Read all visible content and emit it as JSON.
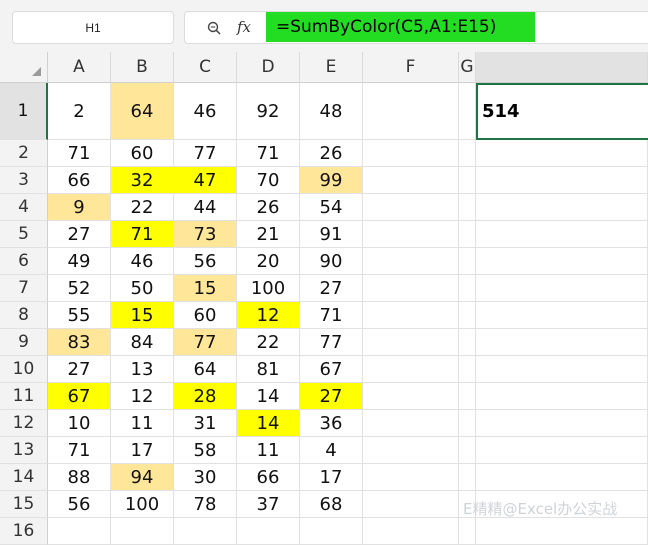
{
  "name_box": "H1",
  "formula": "=SumByColor(C5,A1:E15)",
  "colors": {
    "formula_highlight": "#22dd22",
    "yellow": "#ffff00",
    "light_orange": "#ffe699",
    "selection_border": "#217346"
  },
  "columns": [
    "A",
    "B",
    "C",
    "D",
    "E",
    "F",
    "G"
  ],
  "rows": [
    {
      "num": "1",
      "cells": [
        {
          "v": "2"
        },
        {
          "v": "64",
          "fill": "light_orange"
        },
        {
          "v": "46"
        },
        {
          "v": "92"
        },
        {
          "v": "48"
        }
      ]
    },
    {
      "num": "2",
      "cells": [
        {
          "v": "71"
        },
        {
          "v": "60"
        },
        {
          "v": "77"
        },
        {
          "v": "71"
        },
        {
          "v": "26"
        }
      ]
    },
    {
      "num": "3",
      "cells": [
        {
          "v": "66"
        },
        {
          "v": "32",
          "fill": "yellow"
        },
        {
          "v": "47",
          "fill": "yellow"
        },
        {
          "v": "70"
        },
        {
          "v": "99",
          "fill": "light_orange"
        }
      ]
    },
    {
      "num": "4",
      "cells": [
        {
          "v": "9",
          "fill": "light_orange"
        },
        {
          "v": "22"
        },
        {
          "v": "44"
        },
        {
          "v": "26"
        },
        {
          "v": "54"
        }
      ]
    },
    {
      "num": "5",
      "cells": [
        {
          "v": "27"
        },
        {
          "v": "71",
          "fill": "yellow"
        },
        {
          "v": "73",
          "fill": "light_orange"
        },
        {
          "v": "21"
        },
        {
          "v": "91"
        }
      ]
    },
    {
      "num": "6",
      "cells": [
        {
          "v": "49"
        },
        {
          "v": "46"
        },
        {
          "v": "56"
        },
        {
          "v": "20"
        },
        {
          "v": "90"
        }
      ]
    },
    {
      "num": "7",
      "cells": [
        {
          "v": "52"
        },
        {
          "v": "50"
        },
        {
          "v": "15",
          "fill": "light_orange"
        },
        {
          "v": "100"
        },
        {
          "v": "27"
        }
      ]
    },
    {
      "num": "8",
      "cells": [
        {
          "v": "55"
        },
        {
          "v": "15",
          "fill": "yellow"
        },
        {
          "v": "60"
        },
        {
          "v": "12",
          "fill": "yellow"
        },
        {
          "v": "71"
        }
      ]
    },
    {
      "num": "9",
      "cells": [
        {
          "v": "83",
          "fill": "light_orange"
        },
        {
          "v": "84"
        },
        {
          "v": "77",
          "fill": "light_orange"
        },
        {
          "v": "22"
        },
        {
          "v": "77"
        }
      ]
    },
    {
      "num": "10",
      "cells": [
        {
          "v": "27"
        },
        {
          "v": "13"
        },
        {
          "v": "64"
        },
        {
          "v": "81"
        },
        {
          "v": "67"
        }
      ]
    },
    {
      "num": "11",
      "cells": [
        {
          "v": "67",
          "fill": "yellow"
        },
        {
          "v": "12"
        },
        {
          "v": "28",
          "fill": "yellow"
        },
        {
          "v": "14"
        },
        {
          "v": "27",
          "fill": "yellow"
        }
      ]
    },
    {
      "num": "12",
      "cells": [
        {
          "v": "10"
        },
        {
          "v": "11"
        },
        {
          "v": "31"
        },
        {
          "v": "14",
          "fill": "yellow"
        },
        {
          "v": "36"
        }
      ]
    },
    {
      "num": "13",
      "cells": [
        {
          "v": "71"
        },
        {
          "v": "17"
        },
        {
          "v": "58"
        },
        {
          "v": "11"
        },
        {
          "v": "4"
        }
      ]
    },
    {
      "num": "14",
      "cells": [
        {
          "v": "88"
        },
        {
          "v": "94",
          "fill": "light_orange"
        },
        {
          "v": "30"
        },
        {
          "v": "66"
        },
        {
          "v": "17"
        }
      ]
    },
    {
      "num": "15",
      "cells": [
        {
          "v": "56"
        },
        {
          "v": "100"
        },
        {
          "v": "78"
        },
        {
          "v": "37"
        },
        {
          "v": "68"
        }
      ]
    },
    {
      "num": "16",
      "cells": []
    }
  ],
  "result_cell": {
    "ref": "H1",
    "value": "514"
  },
  "watermark": "E精精@Excel办公实战"
}
